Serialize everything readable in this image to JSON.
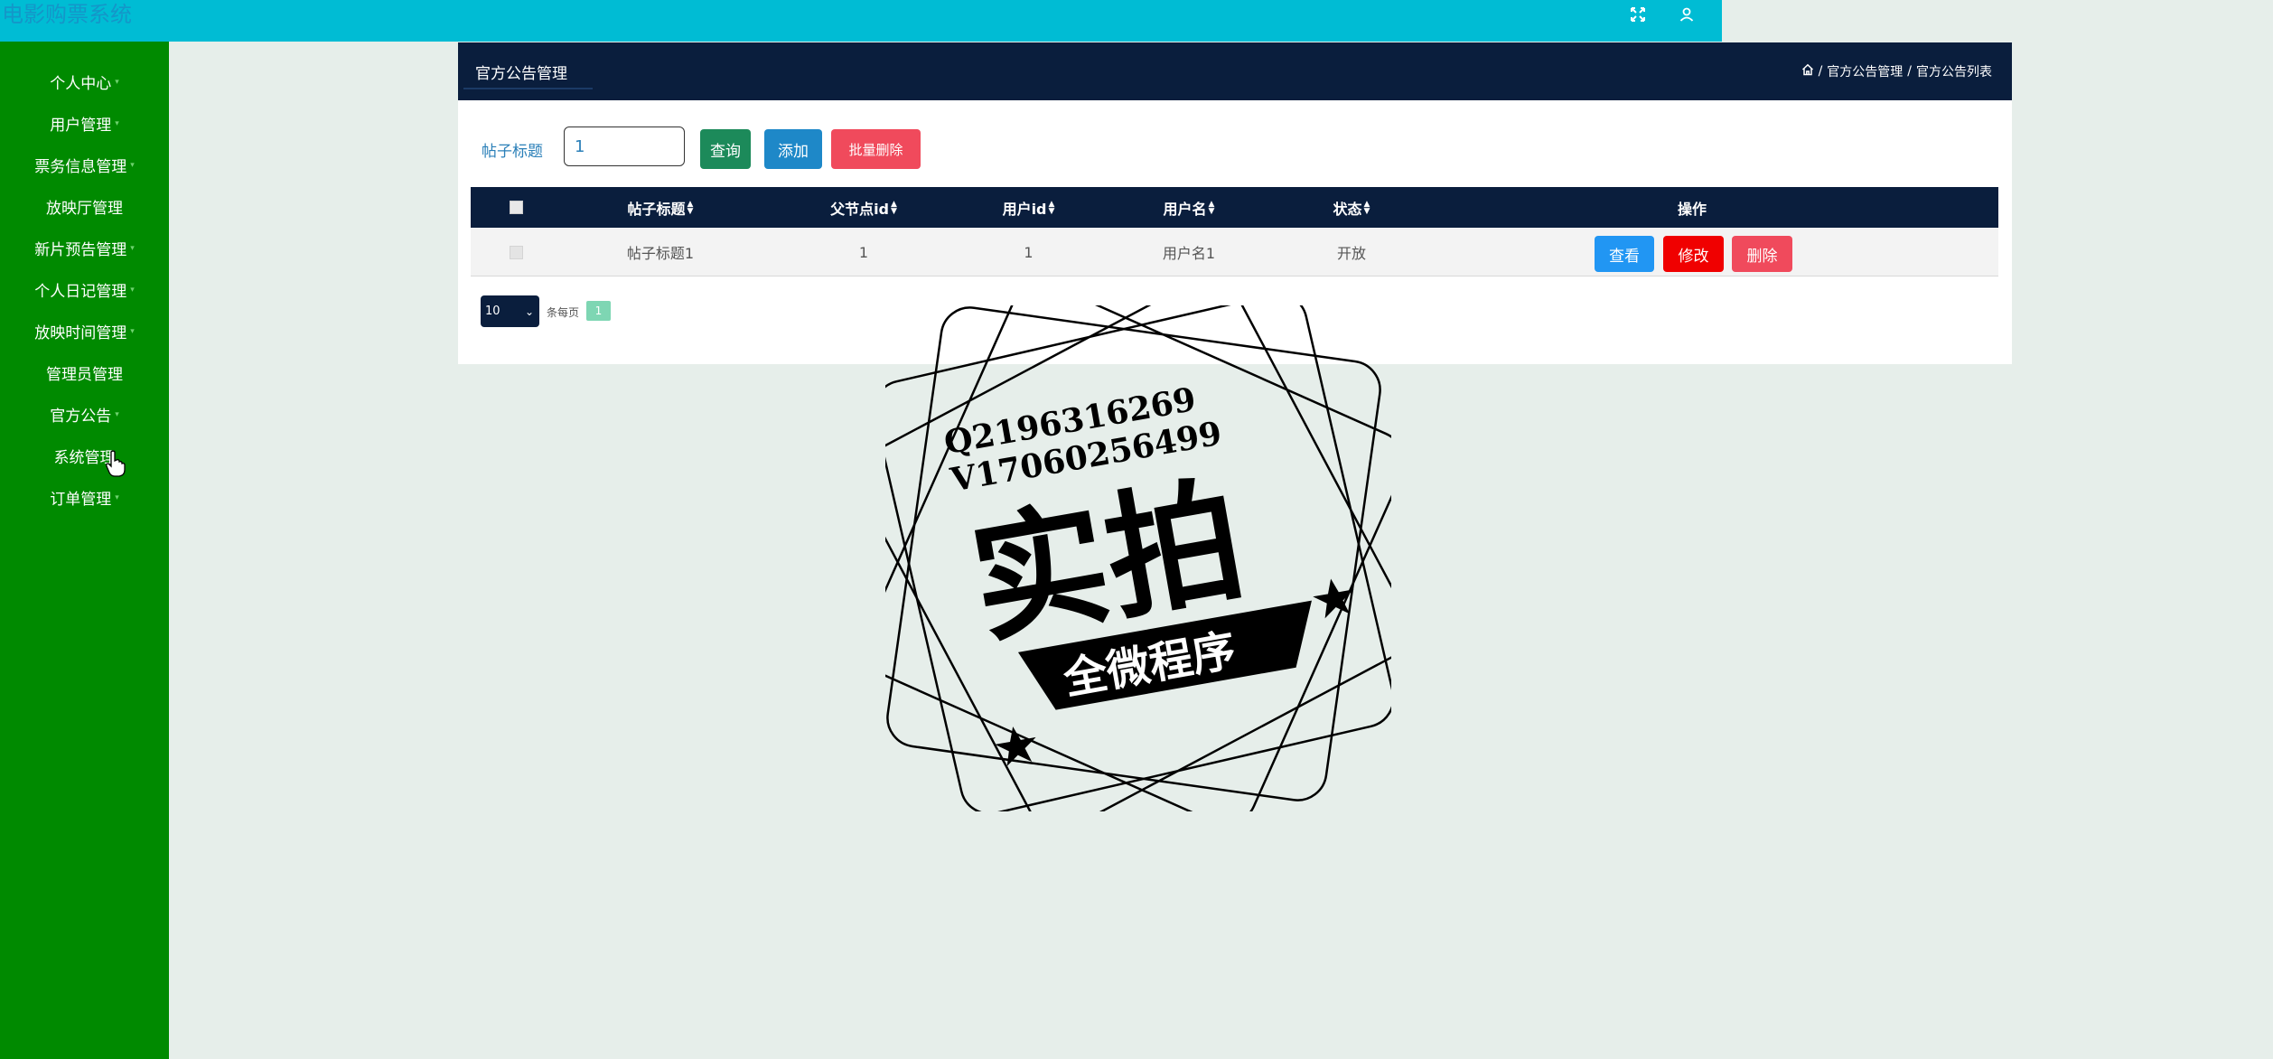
{
  "app": {
    "title": "电影购票系统"
  },
  "topbar": {
    "icons": [
      "fullscreen-icon",
      "user-icon"
    ],
    "background": "#00bcd4"
  },
  "sidebar": {
    "background": "#008a00",
    "items": [
      {
        "label": "个人中心",
        "has_caret": true
      },
      {
        "label": "用户管理",
        "has_caret": true
      },
      {
        "label": "票务信息管理",
        "has_caret": true
      },
      {
        "label": "放映厅管理",
        "has_caret": false
      },
      {
        "label": "新片预告管理",
        "has_caret": true
      },
      {
        "label": "个人日记管理",
        "has_caret": true
      },
      {
        "label": "放映时间管理",
        "has_caret": true
      },
      {
        "label": "管理员管理",
        "has_caret": false
      },
      {
        "label": "官方公告",
        "has_caret": true
      },
      {
        "label": "系统管理",
        "has_caret": false
      },
      {
        "label": "订单管理",
        "has_caret": true
      }
    ]
  },
  "panel": {
    "title": "官方公告管理",
    "breadcrumb": [
      "官方公告管理",
      "官方公告列表"
    ],
    "breadcrumb_separator": "/"
  },
  "search": {
    "label": "帖子标题",
    "value": "1",
    "query_button": "查询",
    "add_button": "添加",
    "batch_delete_button": "批量删除"
  },
  "table": {
    "headers": [
      "帖子标题",
      "父节点id",
      "用户id",
      "用户名",
      "状态",
      "操作"
    ],
    "rows": [
      {
        "title": "帖子标题1",
        "parent_id": "1",
        "user_id": "1",
        "username": "用户名1",
        "status": "开放"
      }
    ],
    "row_actions": {
      "view": "查看",
      "edit": "修改",
      "delete": "删除"
    }
  },
  "pagination": {
    "page_size": "10",
    "per_page_label": "条每页",
    "current_page": "1"
  },
  "watermark": {
    "line1": "Q2196316269",
    "line2": "V17060256499",
    "big_text": "实拍",
    "banner_text": "全微程序"
  },
  "colors": {
    "header_navy": "#0a1e3d",
    "query_button": "#1c8a5a",
    "add_button": "#1e88c8",
    "batch_delete_button": "#f04a5c",
    "view_button": "#2196f3",
    "edit_button": "#f00000",
    "delete_button": "#f04a5c",
    "page_active": "#7ed6b3"
  }
}
